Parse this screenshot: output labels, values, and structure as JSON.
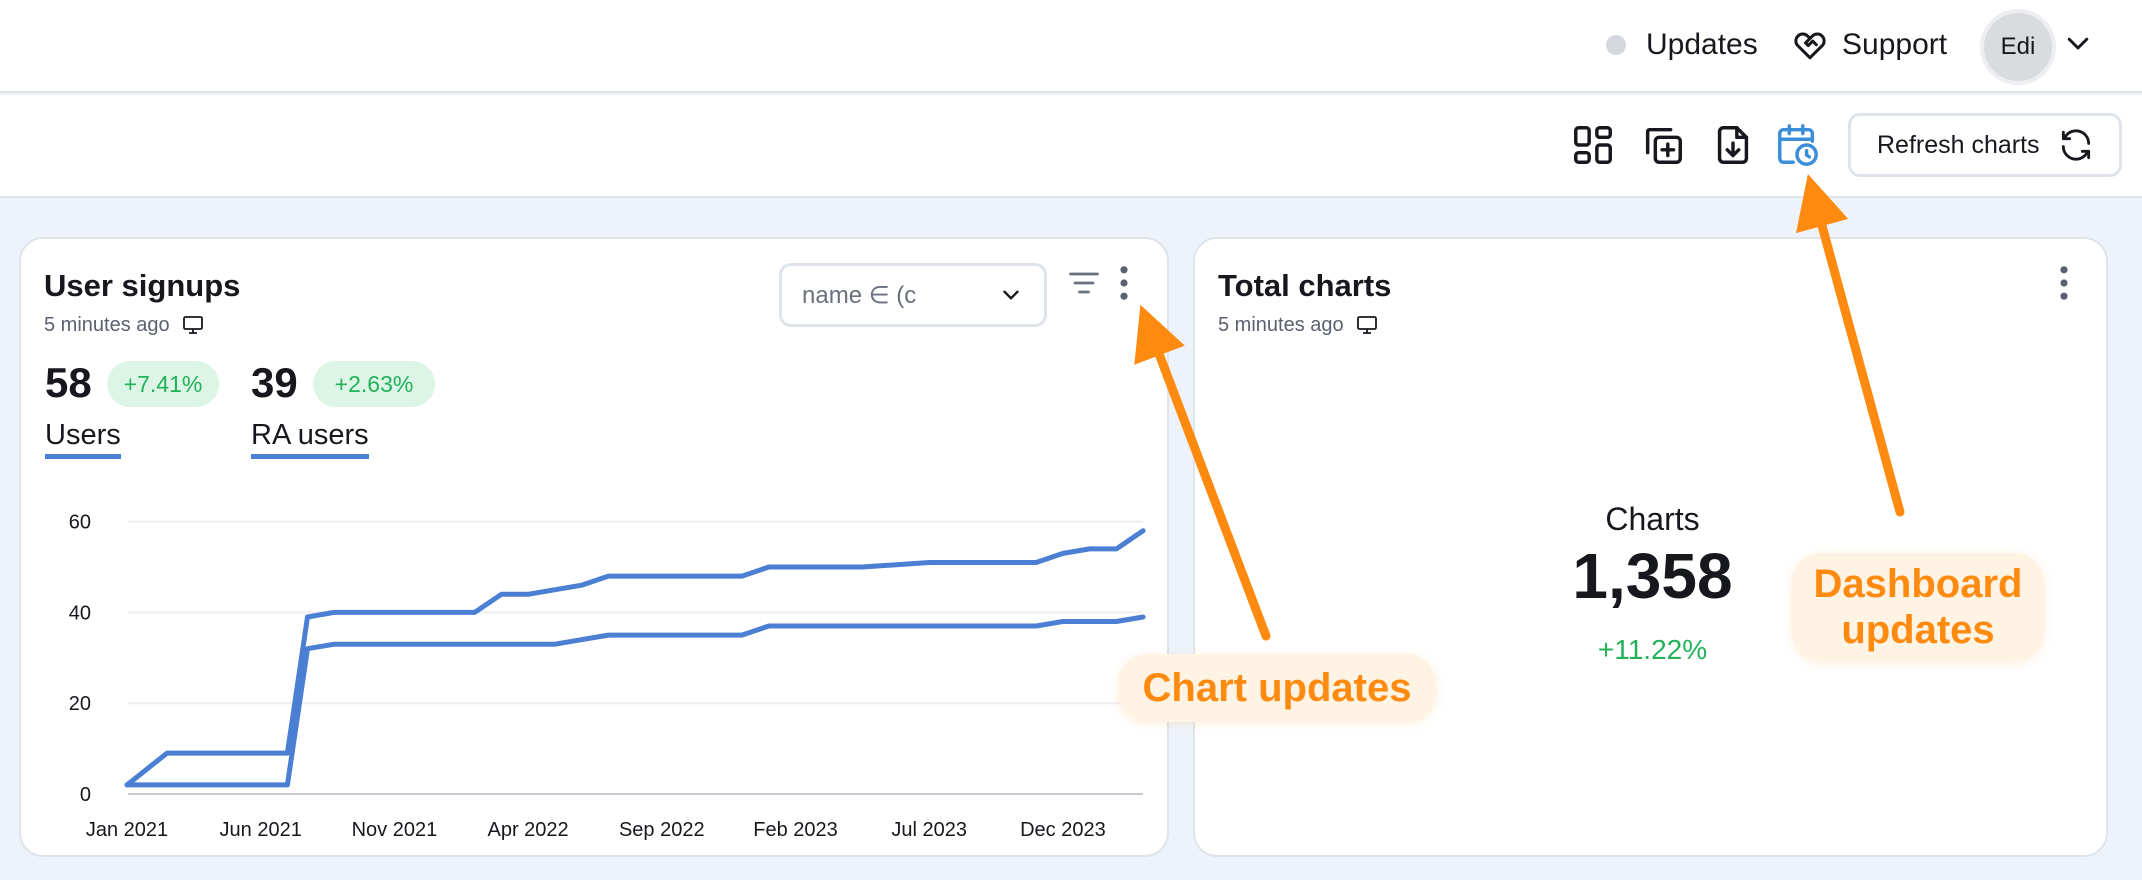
{
  "header": {
    "updates_label": "Updates",
    "support_label": "Support",
    "avatar_initials": "Edi"
  },
  "toolbar": {
    "icons": [
      "layout-grid-icon",
      "duplicate-icon",
      "download-icon",
      "calendar-clock-icon"
    ],
    "refresh_label": "Refresh charts"
  },
  "cards": {
    "signups": {
      "title": "User signups",
      "updated": "5 minutes ago",
      "filter_value": "name ∈ (c",
      "metrics": [
        {
          "value": "58",
          "delta": "+7.41%",
          "name": "Users"
        },
        {
          "value": "39",
          "delta": "+2.63%",
          "name": "RA users"
        }
      ]
    },
    "total": {
      "title": "Total charts",
      "updated": "5 minutes ago",
      "kpi_label": "Charts",
      "kpi_value": "1,358",
      "kpi_delta": "+11.22%"
    }
  },
  "callouts": {
    "chart_updates": "Chart updates",
    "dashboard_updates_line1": "Dashboard",
    "dashboard_updates_line2": "updates"
  },
  "colors": {
    "accent_line": "#4a7fd4",
    "positive": "#22b25a",
    "callout": "#ff8a10",
    "active_icon": "#3b8ed8"
  },
  "chart_data": {
    "type": "line",
    "categories": [
      "Jan 2021",
      "Jun 2021",
      "Nov 2021",
      "Apr 2022",
      "Sep 2022",
      "Feb 2023",
      "Jul 2023",
      "Dec 2023"
    ],
    "y_ticks": [
      0,
      20,
      40,
      60
    ],
    "ylim": [
      0,
      63
    ],
    "grid": true,
    "series": [
      {
        "name": "Users",
        "color": "#4a7fd4",
        "points": [
          [
            0,
            2
          ],
          [
            0.3,
            9
          ],
          [
            1.2,
            9
          ],
          [
            1.35,
            39
          ],
          [
            1.55,
            40
          ],
          [
            2.4,
            40
          ],
          [
            2.6,
            40
          ],
          [
            2.8,
            44
          ],
          [
            3.0,
            44
          ],
          [
            3.4,
            46
          ],
          [
            3.6,
            48
          ],
          [
            4.0,
            48
          ],
          [
            4.6,
            48
          ],
          [
            4.8,
            50
          ],
          [
            5.5,
            50
          ],
          [
            6.0,
            51
          ],
          [
            6.8,
            51
          ],
          [
            7.0,
            53
          ],
          [
            7.2,
            54
          ],
          [
            7.4,
            54
          ],
          [
            7.6,
            58
          ]
        ]
      },
      {
        "name": "RA users",
        "color": "#4a7fd4",
        "points": [
          [
            0,
            2
          ],
          [
            1.2,
            2
          ],
          [
            1.35,
            32
          ],
          [
            1.55,
            33
          ],
          [
            2.4,
            33
          ],
          [
            3.2,
            33
          ],
          [
            3.6,
            35
          ],
          [
            4.0,
            35
          ],
          [
            4.6,
            35
          ],
          [
            4.8,
            37
          ],
          [
            5.5,
            37
          ],
          [
            6.0,
            37
          ],
          [
            6.8,
            37
          ],
          [
            7.0,
            38
          ],
          [
            7.4,
            38
          ],
          [
            7.6,
            39
          ]
        ]
      }
    ]
  }
}
